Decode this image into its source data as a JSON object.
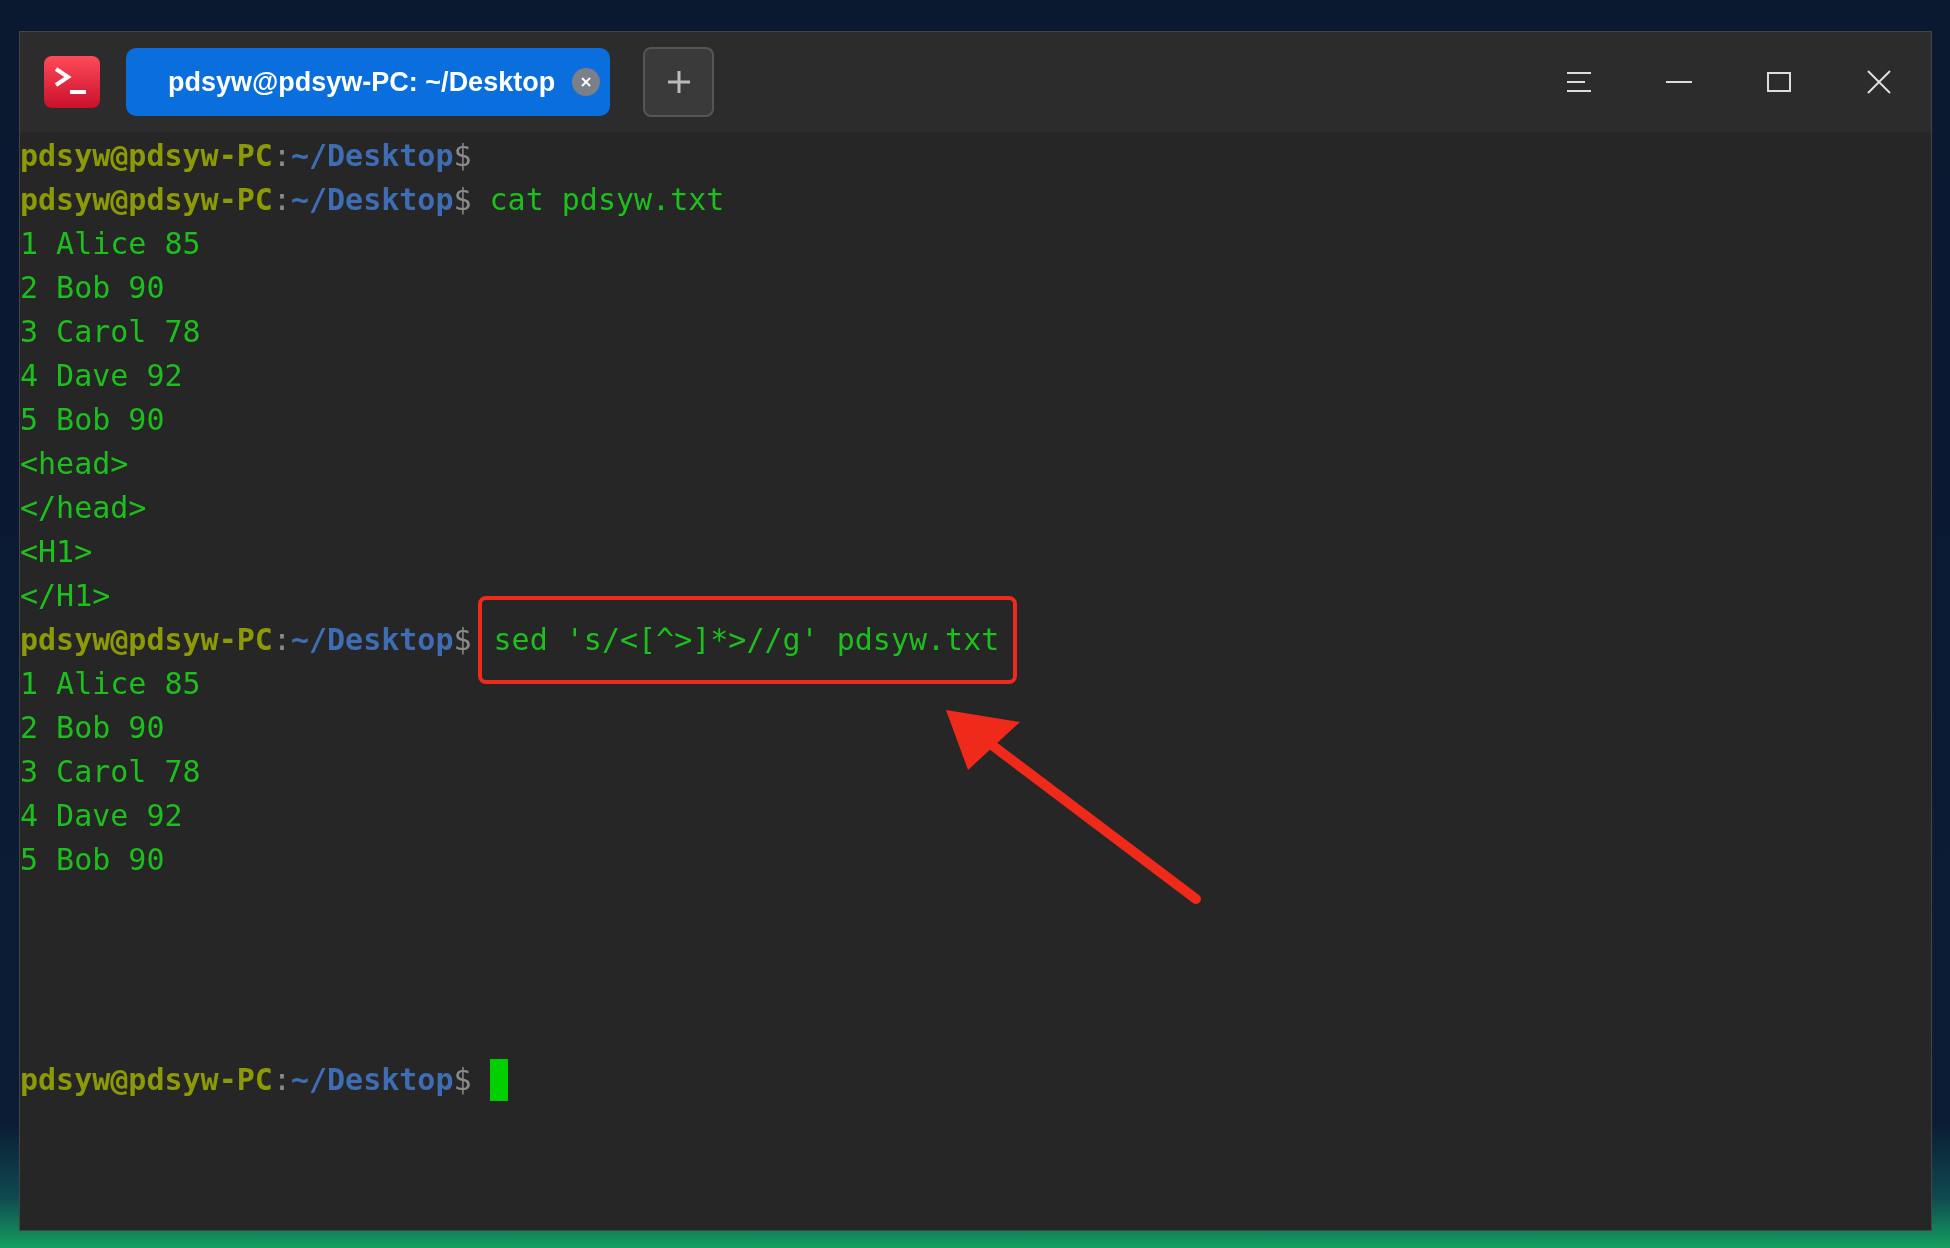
{
  "tab": {
    "title": "pdsyw@pdsyw-PC: ~/Desktop",
    "selected": true
  },
  "terminal": {
    "lines": [
      {
        "kind": "prompt",
        "user": "pdsyw@pdsyw-PC",
        "sep": ":",
        "path": "~/Desktop",
        "symbol": "$",
        "highlighted": false,
        "cursor": false
      },
      {
        "kind": "prompt",
        "user": "pdsyw@pdsyw-PC",
        "sep": ":",
        "path": "~/Desktop",
        "symbol": "$",
        "command": "cat pdsyw.txt",
        "highlighted": false,
        "cursor": false
      },
      {
        "kind": "output",
        "text": "1 Alice 85",
        "highlighted": false
      },
      {
        "kind": "output",
        "text": "2 Bob 90",
        "highlighted": false
      },
      {
        "kind": "output",
        "text": "3 Carol 78",
        "highlighted": false
      },
      {
        "kind": "output",
        "text": "4 Dave 92",
        "highlighted": false
      },
      {
        "kind": "output",
        "text": "5 Bob 90",
        "highlighted": false
      },
      {
        "kind": "output",
        "text": "<head>",
        "highlighted": false
      },
      {
        "kind": "output",
        "text": "</head>",
        "highlighted": false
      },
      {
        "kind": "output",
        "text": "<H1>",
        "highlighted": false
      },
      {
        "kind": "output",
        "text": "</H1>",
        "highlighted": false
      },
      {
        "kind": "prompt",
        "user": "pdsyw@pdsyw-PC",
        "sep": ":",
        "path": "~/Desktop",
        "symbol": "$",
        "command": "sed 's/<[^>]*>//g' pdsyw.txt",
        "highlighted": true,
        "cursor": false
      },
      {
        "kind": "output",
        "text": "1 Alice 85",
        "highlighted": false
      },
      {
        "kind": "output",
        "text": "2 Bob 90",
        "highlighted": false
      },
      {
        "kind": "output",
        "text": "3 Carol 78",
        "highlighted": false
      },
      {
        "kind": "output",
        "text": "4 Dave 92",
        "highlighted": false
      },
      {
        "kind": "output",
        "text": "5 Bob 90",
        "highlighted": false
      },
      {
        "kind": "blank",
        "highlighted": false
      },
      {
        "kind": "blank",
        "highlighted": false
      },
      {
        "kind": "blank",
        "highlighted": false
      },
      {
        "kind": "blank",
        "highlighted": false
      },
      {
        "kind": "prompt",
        "user": "pdsyw@pdsyw-PC",
        "sep": ":",
        "path": "~/Desktop",
        "symbol": "$",
        "highlighted": false,
        "cursor": true
      }
    ]
  }
}
